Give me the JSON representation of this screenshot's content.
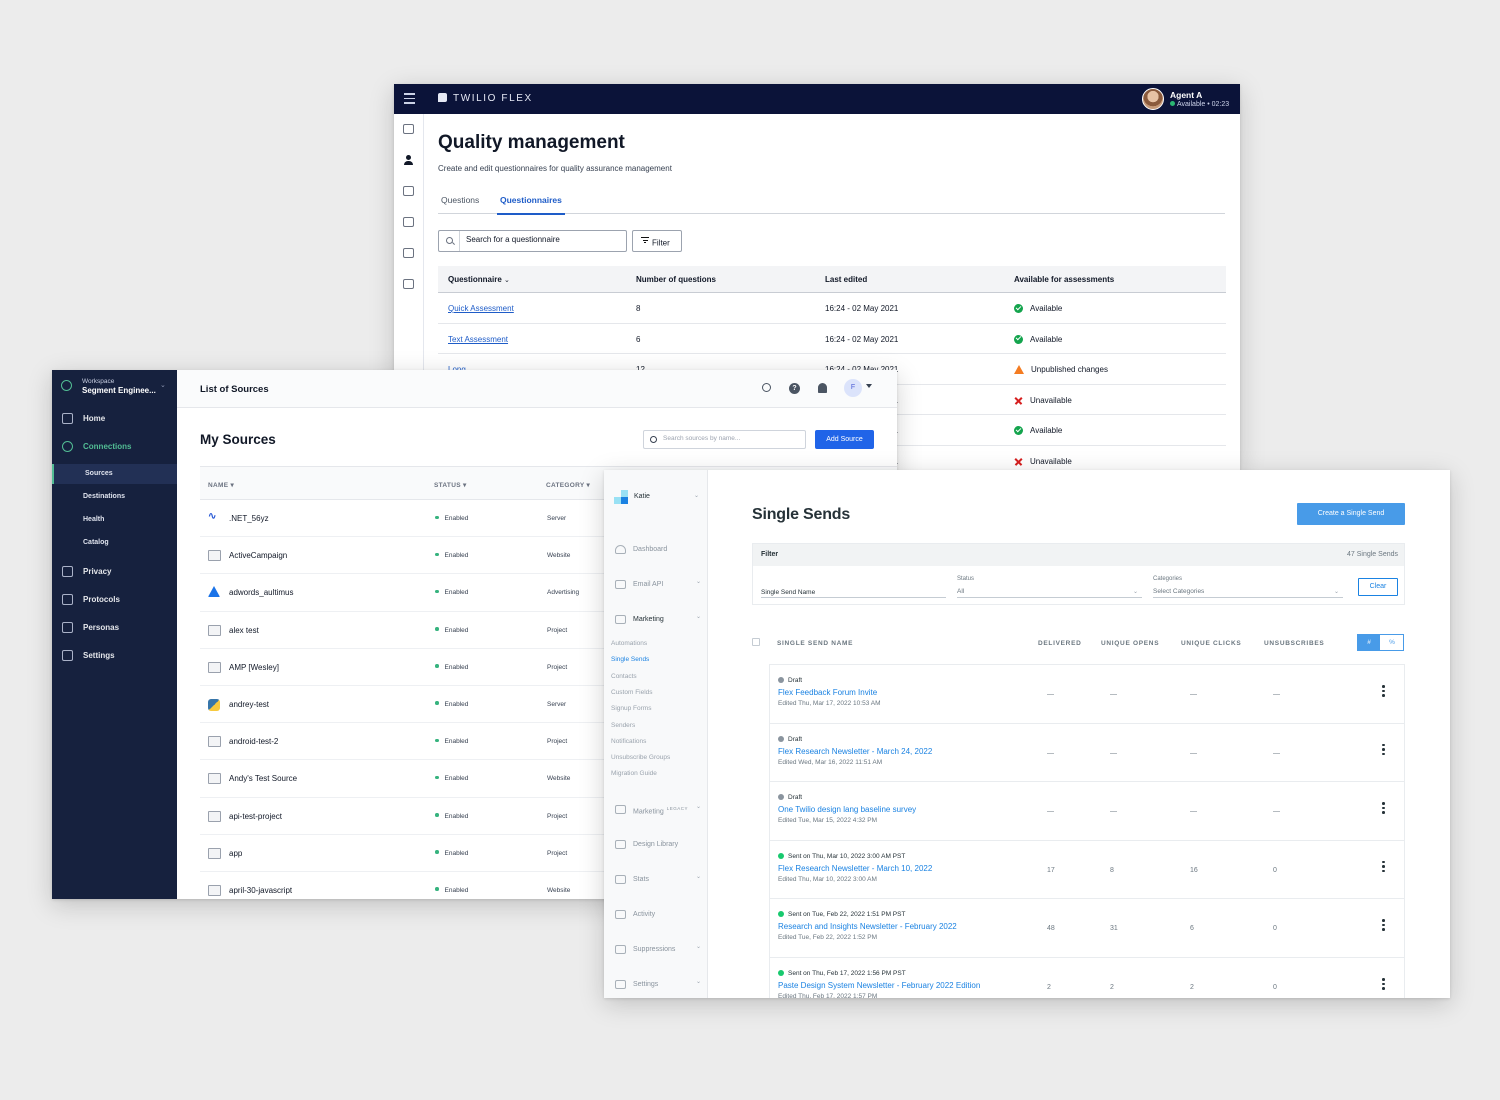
{
  "flex": {
    "brand": "TWILIO FLEX",
    "agent": {
      "name": "Agent A",
      "status": "Available • 02:23",
      "status_color": "#2bb673"
    },
    "title": "Quality management",
    "subtitle": "Create and edit questionnaires for quality assurance management",
    "tabs": [
      {
        "label": "Questions",
        "active": false
      },
      {
        "label": "Questionnaires",
        "active": true
      }
    ],
    "search_placeholder": "Search for a questionnaire",
    "filter_label": "Filter",
    "columns": [
      "Questionnaire",
      "Number of questions",
      "Last edited",
      "Available for assessments"
    ],
    "rows": [
      {
        "name": "Quick Assessment",
        "questions": "8",
        "edited": "16:24 - 02 May 2021",
        "status": "Available",
        "icon": "available"
      },
      {
        "name": "Text Assessment",
        "questions": "6",
        "edited": "16:24 - 02 May 2021",
        "status": "Available",
        "icon": "available"
      },
      {
        "name": "Long",
        "questions": "12",
        "edited": "16:24 - 02 May 2021",
        "status": "Unpublished changes",
        "icon": "unpublished"
      },
      {
        "name": "",
        "questions": "",
        "edited": "21",
        "status": "Unavailable",
        "icon": "unavailable"
      },
      {
        "name": "",
        "questions": "",
        "edited": "21",
        "status": "Available",
        "icon": "available"
      },
      {
        "name": "",
        "questions": "",
        "edited": "21",
        "status": "Unavailable",
        "icon": "unavailable"
      }
    ],
    "colors": {
      "topbar": "#0b1339",
      "accent": "#1e5cc8"
    }
  },
  "segment": {
    "workspace_label": "Workspace",
    "workspace_name": "Segment Enginee...",
    "nav": [
      {
        "label": "Home",
        "icon": "home-icon"
      },
      {
        "label": "Connections",
        "icon": "connections-icon",
        "active": true
      },
      {
        "label": "Privacy",
        "icon": "shield-icon"
      },
      {
        "label": "Protocols",
        "icon": "protocols-icon"
      },
      {
        "label": "Personas",
        "icon": "person-icon"
      },
      {
        "label": "Settings",
        "icon": "gear-icon"
      }
    ],
    "subnav": [
      "Sources",
      "Destinations",
      "Health",
      "Catalog"
    ],
    "header_title": "List of Sources",
    "avatar_initial": "F",
    "page_title": "My Sources",
    "search_placeholder": "Search sources by name...",
    "add_button": "Add Source",
    "columns": [
      "NAME ▾",
      "STATUS ▾",
      "CATEGORY ▾"
    ],
    "sources": [
      {
        "name": ".NET_56yz",
        "status": "Enabled",
        "category": "Server",
        "icon": "net"
      },
      {
        "name": "ActiveCampaign",
        "status": "Enabled",
        "category": "Website",
        "icon": "box"
      },
      {
        "name": "adwords_aultimus",
        "status": "Enabled",
        "category": "Advertising",
        "icon": "ads"
      },
      {
        "name": "alex test",
        "status": "Enabled",
        "category": "Project",
        "icon": "box"
      },
      {
        "name": "AMP [Wesley]",
        "status": "Enabled",
        "category": "Project",
        "icon": "box"
      },
      {
        "name": "andrey-test",
        "status": "Enabled",
        "category": "Server",
        "icon": "py"
      },
      {
        "name": "android-test-2",
        "status": "Enabled",
        "category": "Project",
        "icon": "box"
      },
      {
        "name": "Andy's Test Source",
        "status": "Enabled",
        "category": "Website",
        "icon": "box"
      },
      {
        "name": "api-test-project",
        "status": "Enabled",
        "category": "Project",
        "icon": "box"
      },
      {
        "name": "app",
        "status": "Enabled",
        "category": "Project",
        "icon": "box"
      },
      {
        "name": "april-30-javascript",
        "status": "Enabled",
        "category": "Website",
        "icon": "box"
      }
    ],
    "colors": {
      "sidebar": "#16213e",
      "accent": "#52bd94",
      "button": "#2064e8"
    }
  },
  "sendgrid": {
    "user": "Katie",
    "nav": {
      "dashboard": "Dashboard",
      "email_api": "Email API",
      "marketing": "Marketing",
      "marketing_sub": [
        "Automations",
        "Single Sends",
        "Contacts",
        "Custom Fields",
        "Signup Forms",
        "Senders",
        "Notifications",
        "Unsubscribe Groups",
        "Migration Guide"
      ],
      "marketing_legacy": "Marketing",
      "legacy_tag": "LEGACY",
      "design_library": "Design Library",
      "stats": "Stats",
      "activity": "Activity",
      "suppressions": "Suppressions",
      "settings": "Settings"
    },
    "title": "Single Sends",
    "create_button": "Create a Single Send",
    "filter": {
      "label": "Filter",
      "count": "47 Single Sends",
      "name_placeholder": "Single Send Name",
      "status_label": "Status",
      "status_value": "All",
      "categories_label": "Categories",
      "categories_value": "Select Categories",
      "clear": "Clear"
    },
    "columns": [
      "SINGLE SEND NAME",
      "DELIVERED",
      "UNIQUE OPENS",
      "UNIQUE CLICKS",
      "UNSUBSCRIBES"
    ],
    "toggle": [
      "#",
      "%"
    ],
    "rows": [
      {
        "status": "Draft",
        "dot": "#8a949e",
        "title": "Flex Feedback Forum Invite",
        "edited": "Edited Thu, Mar 17, 2022 10:53 AM",
        "delivered": "—",
        "opens": "—",
        "clicks": "—",
        "unsubs": "—"
      },
      {
        "status": "Draft",
        "dot": "#8a949e",
        "title": "Flex Research Newsletter - March 24, 2022",
        "edited": "Edited Wed, Mar 16, 2022 11:51 AM",
        "delivered": "—",
        "opens": "—",
        "clicks": "—",
        "unsubs": "—"
      },
      {
        "status": "Draft",
        "dot": "#8a949e",
        "title": "One Twilio design lang baseline survey",
        "edited": "Edited Tue, Mar 15, 2022 4:32 PM",
        "delivered": "—",
        "opens": "—",
        "clicks": "—",
        "unsubs": "—"
      },
      {
        "status": "Sent on Thu, Mar 10, 2022 3:00 AM PST",
        "dot": "#18c96e",
        "title": "Flex Research Newsletter - March 10, 2022",
        "edited": "Edited Thu, Mar 10, 2022 3:00 AM",
        "delivered": "17",
        "opens": "8",
        "clicks": "16",
        "unsubs": "0"
      },
      {
        "status": "Sent on Tue, Feb 22, 2022 1:51 PM PST",
        "dot": "#18c96e",
        "title": "Research and Insights Newsletter - February 2022",
        "edited": "Edited Tue, Feb 22, 2022 1:52 PM",
        "delivered": "48",
        "opens": "31",
        "clicks": "6",
        "unsubs": "0"
      },
      {
        "status": "Sent on Thu, Feb 17, 2022 1:56 PM PST",
        "dot": "#18c96e",
        "title": "Paste Design System Newsletter - February 2022 Edition",
        "edited": "Edited Thu, Feb 17, 2022 1:57 PM",
        "delivered": "2",
        "opens": "2",
        "clicks": "2",
        "unsubs": "0"
      }
    ],
    "colors": {
      "link": "#1a82e2",
      "button": "#489be8"
    }
  }
}
